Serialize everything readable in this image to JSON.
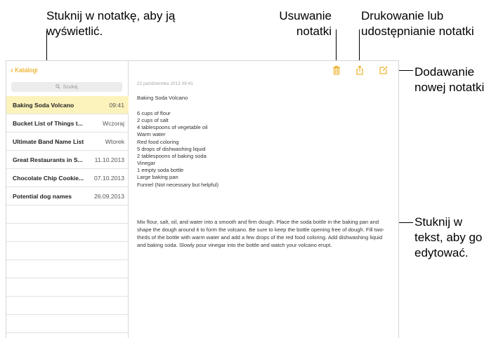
{
  "callouts": {
    "tap_note": [
      "Stuknij w notatkę, aby ją",
      "wyświetlić."
    ],
    "delete": [
      "Usuwanie",
      "notatki"
    ],
    "print_share": [
      "Drukowanie lub",
      "udostępnianie notatki"
    ],
    "new_note": [
      "Dodawanie",
      "nowej notatki"
    ],
    "edit_text": [
      "Stuknij w",
      "tekst, aby go",
      "edytować."
    ]
  },
  "sidebar": {
    "back_label": "Katalogi",
    "search_placeholder": "Szukaj",
    "notes": [
      {
        "title": "Baking Soda Volcano",
        "date": "09:41",
        "selected": true
      },
      {
        "title": "Bucket List of Things t...",
        "date": "Wczoraj"
      },
      {
        "title": "Ultimate Band Name List",
        "date": "Wtorek"
      },
      {
        "title": "Great Restaurants in S...",
        "date": "11.10.2013"
      },
      {
        "title": "Chocolate Chip Cookie...",
        "date": "07.10.2013"
      },
      {
        "title": "Potential dog names",
        "date": "26.09.2013"
      }
    ]
  },
  "toolbar": {
    "icons": [
      "trash-icon",
      "share-icon",
      "compose-icon"
    ]
  },
  "note": {
    "date": "22 października 2013 09:41",
    "title": "Baking Soda Volcano",
    "ingredients": [
      "6 cups of flour",
      "2 cups of salt",
      "4 tablespoons of vegetable oil",
      "Warm water",
      "Red food coloring",
      "5 drops of dishwashing liquid",
      "2 tablespoons of baking soda",
      "Vinegar",
      "1 empty soda bottle",
      "Large baking pan",
      "Funnel (Not necessary but helpful)"
    ],
    "instructions": "Mix flour, salt, oil, and water into a smooth and firm dough.  Place the soda bottle in the baking pan and shape the dough around it to form the volcano.  Be sure to keep the bottle opening free of dough.  Fill two-thirds of the bottle with warm water and add a few drops of the red food coloring. Add dishwashing liquid and baking soda. Slowly pour vinegar into the bottle and watch your volcano erupt."
  },
  "colors": {
    "accent": "#e8a200",
    "selected_row": "#fcf3bc"
  }
}
